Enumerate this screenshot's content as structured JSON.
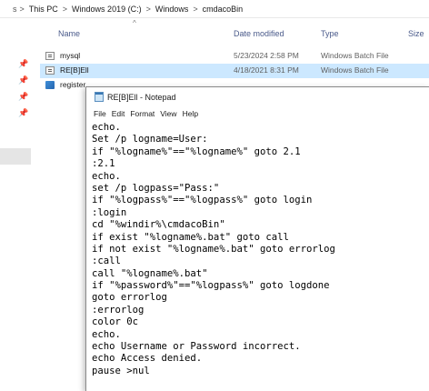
{
  "breadcrumb": {
    "lead": "s",
    "items": [
      "This PC",
      "Windows 2019 (C:)",
      "Windows",
      "cmdacoBin"
    ],
    "separator": ">"
  },
  "columns": {
    "name": "Name",
    "date_modified": "Date modified",
    "type": "Type",
    "size": "Size"
  },
  "files": [
    {
      "name": "mysql",
      "date": "5/23/2024 2:58 PM",
      "type": "Windows Batch File",
      "icon": "batch-file-icon",
      "selected": false
    },
    {
      "name": "RE[B]Ell",
      "date": "4/18/2021 8:31 PM",
      "type": "Windows Batch File",
      "icon": "batch-file-icon",
      "selected": true
    },
    {
      "name": "register",
      "date": "",
      "type": "",
      "icon": "registry-file-icon",
      "selected": false
    }
  ],
  "notepad": {
    "title": "RE[B]Ell - Notepad",
    "menu": [
      "File",
      "Edit",
      "Format",
      "View",
      "Help"
    ],
    "lines": [
      "echo.",
      "Set /p logname=User:",
      "if \"%logname%\"==\"%logname%\" goto 2.1",
      ":2.1",
      "echo.",
      "set /p logpass=\"Pass:\"",
      "if \"%logpass%\"==\"%logpass%\" goto login",
      ":login",
      "cd \"%windir%\\cmdacoBin\"",
      "if exist \"%logname%.bat\" goto call",
      "if not exist \"%logname%.bat\" goto errorlog",
      ":call",
      "call \"%logname%.bat\"",
      "if \"%password%\"==\"%logpass%\" goto logdone",
      "goto errorlog",
      ":errorlog",
      "color 0c",
      "echo.",
      "echo Username or Password incorrect.",
      "echo Access denied.",
      "pause >nul"
    ]
  },
  "colors": {
    "selection": "#cce8ff",
    "header_text": "#4a5a8a",
    "secondary_text": "#5f5f5f"
  }
}
